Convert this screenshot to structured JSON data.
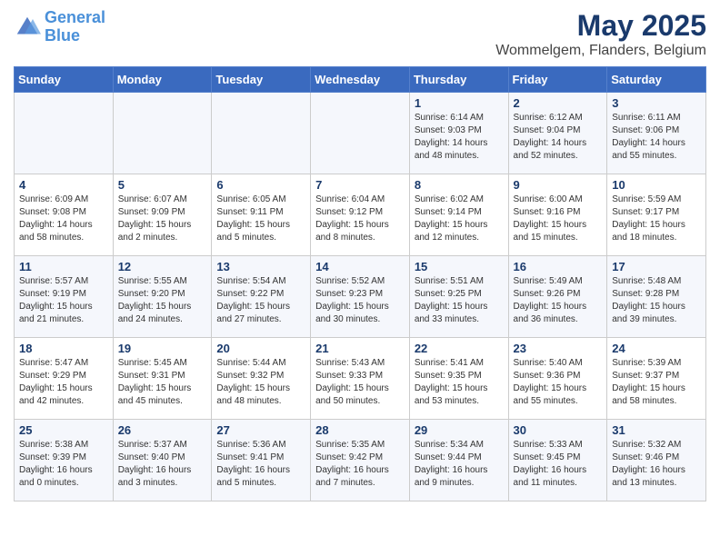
{
  "header": {
    "logo_line1": "General",
    "logo_line2": "Blue",
    "month": "May 2025",
    "location": "Wommelgem, Flanders, Belgium"
  },
  "weekdays": [
    "Sunday",
    "Monday",
    "Tuesday",
    "Wednesday",
    "Thursday",
    "Friday",
    "Saturday"
  ],
  "weeks": [
    [
      {
        "day": "",
        "info": ""
      },
      {
        "day": "",
        "info": ""
      },
      {
        "day": "",
        "info": ""
      },
      {
        "day": "",
        "info": ""
      },
      {
        "day": "1",
        "info": "Sunrise: 6:14 AM\nSunset: 9:03 PM\nDaylight: 14 hours\nand 48 minutes."
      },
      {
        "day": "2",
        "info": "Sunrise: 6:12 AM\nSunset: 9:04 PM\nDaylight: 14 hours\nand 52 minutes."
      },
      {
        "day": "3",
        "info": "Sunrise: 6:11 AM\nSunset: 9:06 PM\nDaylight: 14 hours\nand 55 minutes."
      }
    ],
    [
      {
        "day": "4",
        "info": "Sunrise: 6:09 AM\nSunset: 9:08 PM\nDaylight: 14 hours\nand 58 minutes."
      },
      {
        "day": "5",
        "info": "Sunrise: 6:07 AM\nSunset: 9:09 PM\nDaylight: 15 hours\nand 2 minutes."
      },
      {
        "day": "6",
        "info": "Sunrise: 6:05 AM\nSunset: 9:11 PM\nDaylight: 15 hours\nand 5 minutes."
      },
      {
        "day": "7",
        "info": "Sunrise: 6:04 AM\nSunset: 9:12 PM\nDaylight: 15 hours\nand 8 minutes."
      },
      {
        "day": "8",
        "info": "Sunrise: 6:02 AM\nSunset: 9:14 PM\nDaylight: 15 hours\nand 12 minutes."
      },
      {
        "day": "9",
        "info": "Sunrise: 6:00 AM\nSunset: 9:16 PM\nDaylight: 15 hours\nand 15 minutes."
      },
      {
        "day": "10",
        "info": "Sunrise: 5:59 AM\nSunset: 9:17 PM\nDaylight: 15 hours\nand 18 minutes."
      }
    ],
    [
      {
        "day": "11",
        "info": "Sunrise: 5:57 AM\nSunset: 9:19 PM\nDaylight: 15 hours\nand 21 minutes."
      },
      {
        "day": "12",
        "info": "Sunrise: 5:55 AM\nSunset: 9:20 PM\nDaylight: 15 hours\nand 24 minutes."
      },
      {
        "day": "13",
        "info": "Sunrise: 5:54 AM\nSunset: 9:22 PM\nDaylight: 15 hours\nand 27 minutes."
      },
      {
        "day": "14",
        "info": "Sunrise: 5:52 AM\nSunset: 9:23 PM\nDaylight: 15 hours\nand 30 minutes."
      },
      {
        "day": "15",
        "info": "Sunrise: 5:51 AM\nSunset: 9:25 PM\nDaylight: 15 hours\nand 33 minutes."
      },
      {
        "day": "16",
        "info": "Sunrise: 5:49 AM\nSunset: 9:26 PM\nDaylight: 15 hours\nand 36 minutes."
      },
      {
        "day": "17",
        "info": "Sunrise: 5:48 AM\nSunset: 9:28 PM\nDaylight: 15 hours\nand 39 minutes."
      }
    ],
    [
      {
        "day": "18",
        "info": "Sunrise: 5:47 AM\nSunset: 9:29 PM\nDaylight: 15 hours\nand 42 minutes."
      },
      {
        "day": "19",
        "info": "Sunrise: 5:45 AM\nSunset: 9:31 PM\nDaylight: 15 hours\nand 45 minutes."
      },
      {
        "day": "20",
        "info": "Sunrise: 5:44 AM\nSunset: 9:32 PM\nDaylight: 15 hours\nand 48 minutes."
      },
      {
        "day": "21",
        "info": "Sunrise: 5:43 AM\nSunset: 9:33 PM\nDaylight: 15 hours\nand 50 minutes."
      },
      {
        "day": "22",
        "info": "Sunrise: 5:41 AM\nSunset: 9:35 PM\nDaylight: 15 hours\nand 53 minutes."
      },
      {
        "day": "23",
        "info": "Sunrise: 5:40 AM\nSunset: 9:36 PM\nDaylight: 15 hours\nand 55 minutes."
      },
      {
        "day": "24",
        "info": "Sunrise: 5:39 AM\nSunset: 9:37 PM\nDaylight: 15 hours\nand 58 minutes."
      }
    ],
    [
      {
        "day": "25",
        "info": "Sunrise: 5:38 AM\nSunset: 9:39 PM\nDaylight: 16 hours\nand 0 minutes."
      },
      {
        "day": "26",
        "info": "Sunrise: 5:37 AM\nSunset: 9:40 PM\nDaylight: 16 hours\nand 3 minutes."
      },
      {
        "day": "27",
        "info": "Sunrise: 5:36 AM\nSunset: 9:41 PM\nDaylight: 16 hours\nand 5 minutes."
      },
      {
        "day": "28",
        "info": "Sunrise: 5:35 AM\nSunset: 9:42 PM\nDaylight: 16 hours\nand 7 minutes."
      },
      {
        "day": "29",
        "info": "Sunrise: 5:34 AM\nSunset: 9:44 PM\nDaylight: 16 hours\nand 9 minutes."
      },
      {
        "day": "30",
        "info": "Sunrise: 5:33 AM\nSunset: 9:45 PM\nDaylight: 16 hours\nand 11 minutes."
      },
      {
        "day": "31",
        "info": "Sunrise: 5:32 AM\nSunset: 9:46 PM\nDaylight: 16 hours\nand 13 minutes."
      }
    ]
  ]
}
